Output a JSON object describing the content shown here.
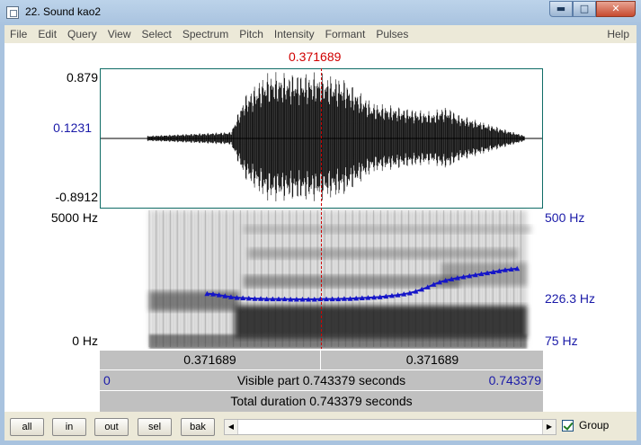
{
  "window": {
    "title": "22. Sound kao2",
    "min_glyph": "▬",
    "max_glyph": "□",
    "close_glyph": "✕"
  },
  "menu": {
    "items": [
      "File",
      "Edit",
      "Query",
      "View",
      "Select",
      "Spectrum",
      "Pitch",
      "Intensity",
      "Formant",
      "Pulses"
    ],
    "help": "Help"
  },
  "cursor": {
    "time_label": "0.371689",
    "position_fraction": 0.5
  },
  "waveform": {
    "max_label": "0.879",
    "cursor_value_label": "0.1231",
    "min_label": "-0.8912"
  },
  "spectrogram": {
    "max_freq_label": "5000 Hz",
    "min_freq_label": "0 Hz",
    "pitch_max_label": "500 Hz",
    "pitch_cursor_label": "226.3 Hz",
    "pitch_min_label": "75 Hz"
  },
  "pitch_track": {
    "times": [
      0.18,
      0.19,
      0.2,
      0.21,
      0.22,
      0.23,
      0.24,
      0.25,
      0.26,
      0.27,
      0.28,
      0.29,
      0.3,
      0.31,
      0.32,
      0.33,
      0.34,
      0.35,
      0.36,
      0.37,
      0.38,
      0.39,
      0.4,
      0.41,
      0.42,
      0.43,
      0.44,
      0.45,
      0.46,
      0.47,
      0.48,
      0.49,
      0.5,
      0.51,
      0.52,
      0.53,
      0.54,
      0.55,
      0.56,
      0.57,
      0.58,
      0.59,
      0.6,
      0.61,
      0.62,
      0.63,
      0.64,
      0.65,
      0.66,
      0.67,
      0.68,
      0.69,
      0.7
    ],
    "hz": [
      242,
      241,
      238,
      235,
      232,
      230,
      229,
      228,
      227,
      227,
      226,
      226,
      226,
      226,
      225,
      225,
      225,
      225,
      225,
      226,
      226,
      226,
      226,
      227,
      227,
      228,
      229,
      230,
      231,
      232,
      234,
      236,
      238,
      241,
      244,
      249,
      255,
      262,
      270,
      277,
      282,
      286,
      290,
      293,
      296,
      299,
      302,
      305,
      308,
      311,
      314,
      316,
      318
    ],
    "color": "#1515c8"
  },
  "selection_bar": {
    "left_label": "0.371689",
    "right_label": "0.371689"
  },
  "visible_bar": {
    "start": "0",
    "label": "Visible part 0.743379 seconds",
    "end": "0.743379"
  },
  "total_bar": {
    "label": "Total duration 0.743379 seconds"
  },
  "toolbar": {
    "buttons": [
      "all",
      "in",
      "out",
      "sel",
      "bak"
    ],
    "scroll_left": "◀",
    "scroll_right": "▶",
    "group_label": "Group",
    "group_checked": true
  }
}
